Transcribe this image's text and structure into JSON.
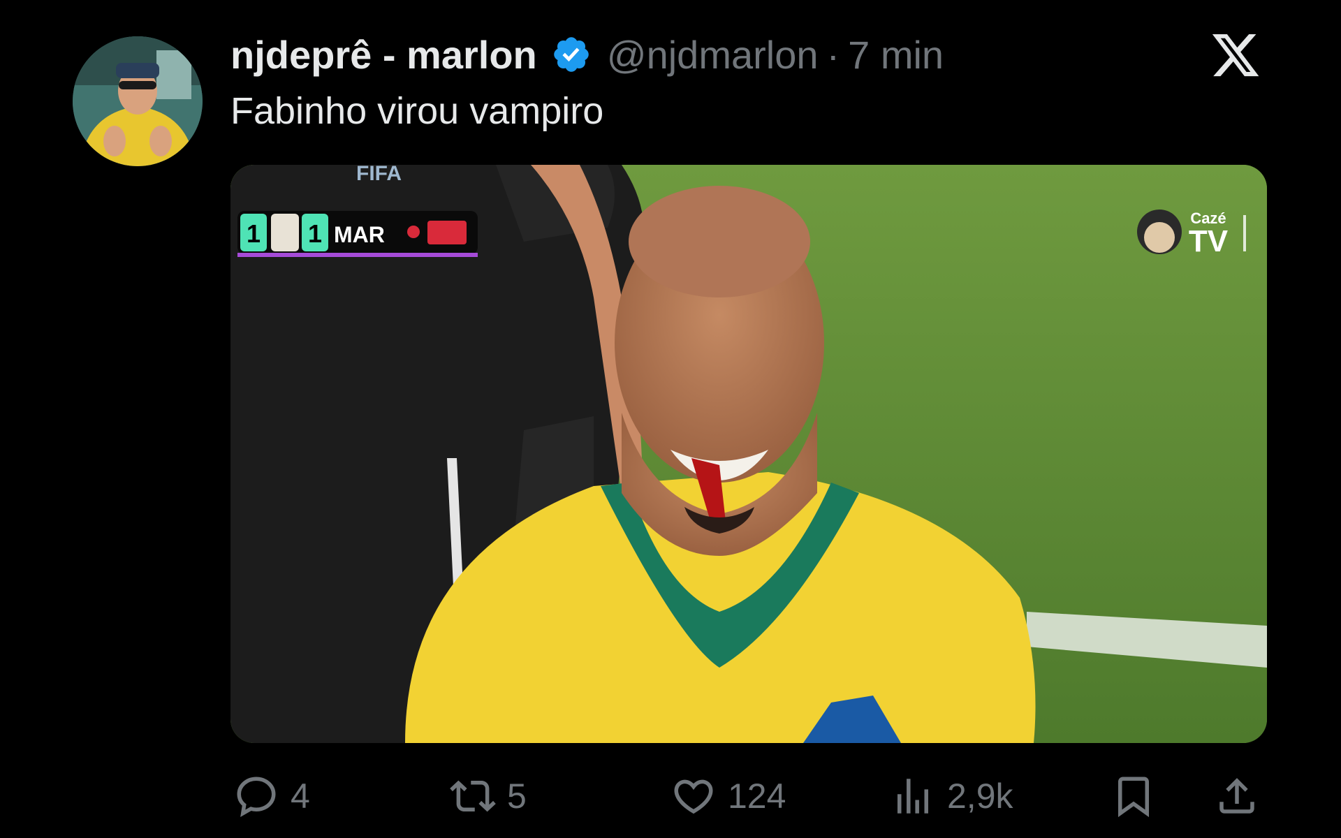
{
  "tweet": {
    "display_name": "njdeprê - marlon",
    "handle": "@njdmarlon",
    "separator": "·",
    "time": "7 min",
    "text": "Fabinho virou vampiro",
    "verified": true,
    "avatar_icon": "profile-photo"
  },
  "media": {
    "scoreboard": {
      "home_score": "1",
      "away_score": "1",
      "away_team": "MAR"
    },
    "broadcaster_logo": {
      "line1": "Cazé",
      "line2": "TV"
    },
    "referee_badge": "FIFA",
    "colors": {
      "pitch": "#5f8a36",
      "jersey": "#f2d233",
      "collar": "#1a7a5c"
    }
  },
  "actions": {
    "replies": "4",
    "reposts": "5",
    "likes": "124",
    "views": "2,9k"
  },
  "theme": {
    "background": "#000000",
    "text": "#e7e9ea",
    "muted": "#71767b",
    "verified_blue": "#1d9bf0"
  }
}
